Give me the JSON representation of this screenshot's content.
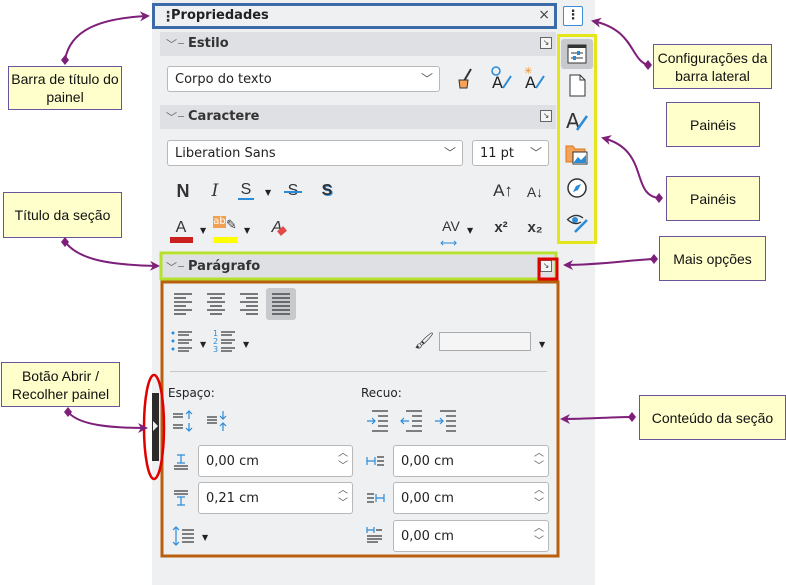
{
  "panel": {
    "title": "Propriedades",
    "grip_glyph": "⋮",
    "close_glyph": "×",
    "settings_glyph": "⋮"
  },
  "sections": {
    "estilo": {
      "title": "Estilo",
      "style_value": "Corpo do texto",
      "buttons": [
        "Limpar formatação direta",
        "Atualizar estilo",
        "Novo estilo"
      ]
    },
    "caractere": {
      "title": "Caractere",
      "font_name": "Liberation Sans",
      "font_size": "11 pt",
      "bold": "N",
      "italic": "I",
      "underline": "S",
      "strikethrough": "S",
      "shadow": "S",
      "grow": "A↑",
      "shrink": "A↓",
      "font_color": "A",
      "highlight": "ab",
      "clear": "A",
      "spacing": "AV",
      "superscript": "x²",
      "subscript": "x₂",
      "font_color_hex": "#c9211e",
      "highlight_hex": "#ffff00"
    },
    "paragrafo": {
      "title": "Parágrafo",
      "espaco_label": "Espaço:",
      "recuo_label": "Recuo:",
      "above_spacing": "0,00 cm",
      "below_spacing": "0,21 cm",
      "indent_before": "0,00 cm",
      "indent_after": "0,00 cm",
      "first_line": "0,00 cm",
      "background_color": ""
    }
  },
  "tabs": [
    "Propriedades",
    "Página",
    "Estilos",
    "Galeria",
    "Navegador",
    "Gerenciar alterações"
  ],
  "callouts": {
    "barra_titulo": "Barra de título do painel",
    "titulo_secao": "Título da seção",
    "botao_abrir": "Botão Abrir / Recolher painel",
    "config": "Configurações da barra lateral",
    "paineis1": "Painéis",
    "paineis2": "Painéis",
    "mais_opcoes": "Mais opções",
    "conteudo": "Conteúdo da seção"
  },
  "colors": {
    "title_highlight": "#3d6ba8",
    "tabs_highlight": "#e5e619",
    "section_title_highlight": "#b5e02e",
    "more_options_highlight": "#e00000",
    "content_highlight": "#b8600d",
    "collapse_highlight": "#e00000",
    "arrow": "#7e1f7a",
    "callout_bg": "#ffffcc"
  }
}
